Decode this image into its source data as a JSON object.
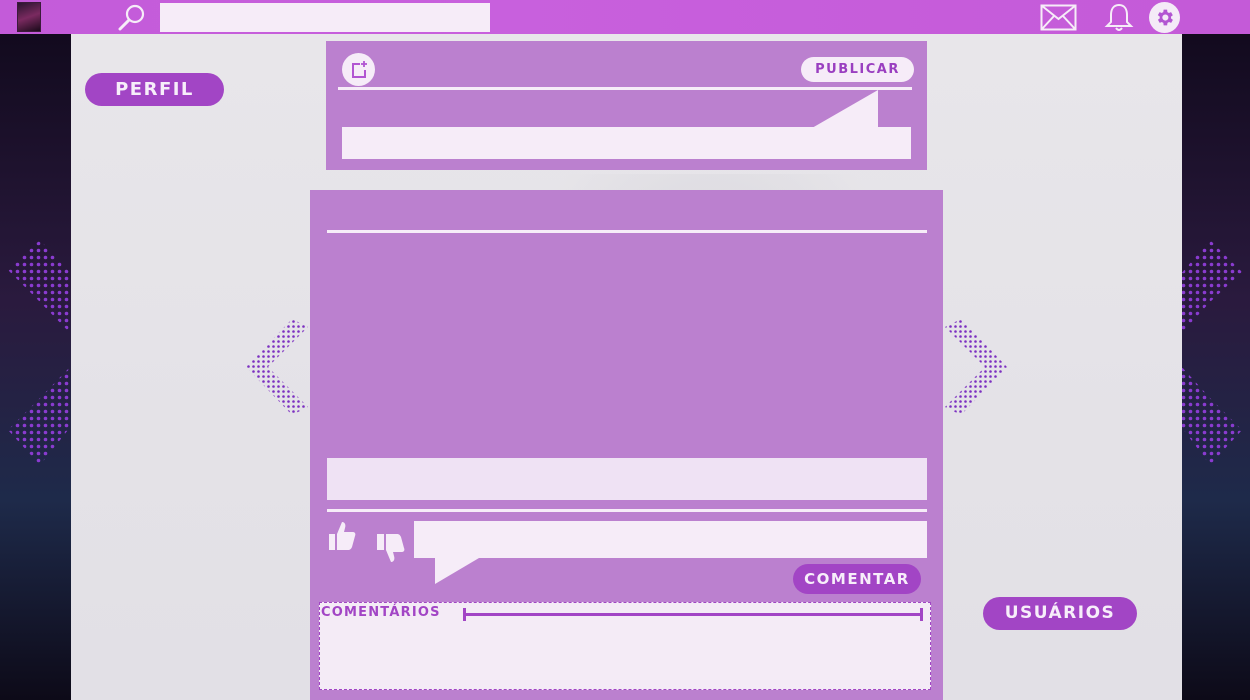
{
  "topbar": {
    "search": {
      "placeholder": "",
      "value": ""
    },
    "icons": [
      "avatar",
      "search-icon",
      "mail-icon",
      "bell-icon",
      "gear-icon"
    ]
  },
  "sidebar_left": {
    "perfil_label": "PERFIL"
  },
  "sidebar_right": {
    "usuarios_label": "USUÁRIOS"
  },
  "composer": {
    "publish_label": "PUBLICAR",
    "input_placeholder": "",
    "add_media_icon": "add-media-icon"
  },
  "post": {
    "caption": "",
    "comment_placeholder": "",
    "comment_button_label": "COMENTAR",
    "comments_title": "COMENTÁRIOS",
    "like_icon": "thumbs-up-icon",
    "dislike_icon": "thumbs-down-icon"
  },
  "navigation": {
    "prev_icon": "chevron-left-icon",
    "next_icon": "chevron-right-icon"
  },
  "colors": {
    "topbar": "#c860dd",
    "accent": "#a245c5",
    "card": "#bb80cf",
    "card_light": "#f6ecf8",
    "panel": "#e6e4e9"
  }
}
